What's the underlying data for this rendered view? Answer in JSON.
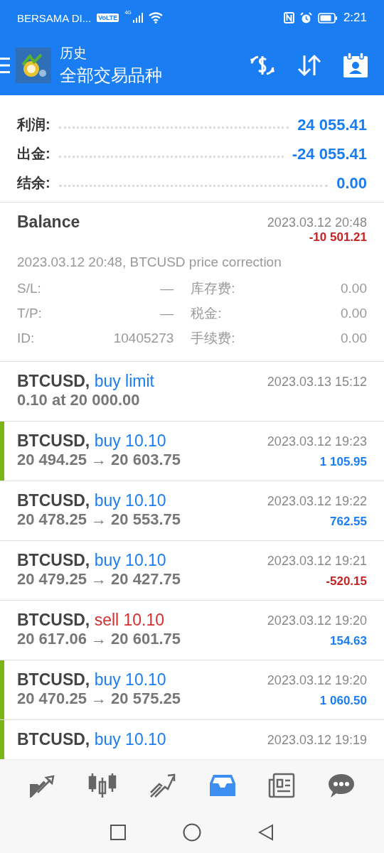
{
  "status_bar": {
    "carrier": "BERSAMA DI...",
    "volte": "VoLTE",
    "network": "4G",
    "time": "2:21"
  },
  "header": {
    "title": "历史",
    "subtitle": "全部交易品种"
  },
  "summary": [
    {
      "label": "利润:",
      "value": "24 055.41"
    },
    {
      "label": "出金:",
      "value": "-24 055.41"
    },
    {
      "label": "结余:",
      "value": "0.00"
    }
  ],
  "balance": {
    "title": "Balance",
    "time": "2023.03.12 20:48",
    "amount": "-10 501.21",
    "loss": true,
    "comment": "2023.03.12 20:48, BTCUSD price correction",
    "details": [
      {
        "label": "S/L:",
        "value": "—",
        "label2": "库存费:",
        "value2": "0.00"
      },
      {
        "label": "T/P:",
        "value": "—",
        "label2": "税金:",
        "value2": "0.00"
      },
      {
        "label": "ID:",
        "value": "10405273",
        "label2": "手续费:",
        "value2": "0.00"
      }
    ]
  },
  "trades": [
    {
      "symbol": "BTCUSD,",
      "kind": "buy",
      "action": "buy limit",
      "prices": "0.10 at 20 000.00",
      "time": "2023.03.13 15:12",
      "marked": false
    },
    {
      "symbol": "BTCUSD,",
      "kind": "buy",
      "action": "buy 10.10",
      "prices": "20 494.25 → 20 603.75",
      "time": "2023.03.12 19:23",
      "profit": "1 105.95",
      "loss": false,
      "marked": true
    },
    {
      "symbol": "BTCUSD,",
      "kind": "buy",
      "action": "buy 10.10",
      "prices": "20 478.25 → 20 553.75",
      "time": "2023.03.12 19:22",
      "profit": "762.55",
      "loss": false,
      "marked": false
    },
    {
      "symbol": "BTCUSD,",
      "kind": "buy",
      "action": "buy 10.10",
      "prices": "20 479.25 → 20 427.75",
      "time": "2023.03.12 19:21",
      "profit": "-520.15",
      "loss": true,
      "marked": false
    },
    {
      "symbol": "BTCUSD,",
      "kind": "sell",
      "action": "sell 10.10",
      "prices": "20 617.06 → 20 601.75",
      "time": "2023.03.12 19:20",
      "profit": "154.63",
      "loss": false,
      "marked": false
    },
    {
      "symbol": "BTCUSD,",
      "kind": "buy",
      "action": "buy 10.10",
      "prices": "20 470.25 → 20 575.25",
      "time": "2023.03.12 19:20",
      "profit": "1 060.50",
      "loss": false,
      "marked": true
    },
    {
      "symbol": "BTCUSD,",
      "kind": "buy",
      "action": "buy 10.10",
      "time": "2023.03.12 19:19",
      "marked": true
    }
  ],
  "bottom_nav": [
    {
      "selected": false
    },
    {
      "selected": false
    },
    {
      "selected": false
    },
    {
      "selected": true
    },
    {
      "selected": false
    },
    {
      "selected": false
    }
  ]
}
